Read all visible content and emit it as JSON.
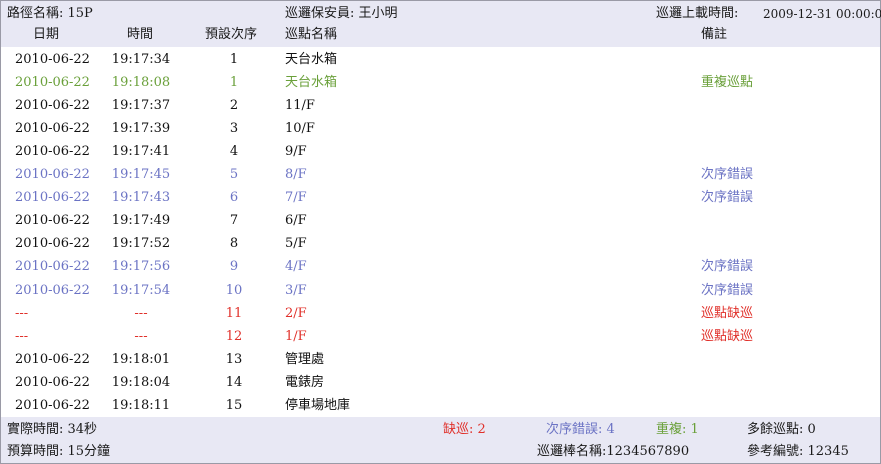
{
  "header": {
    "route_label": "路徑名稱: 15P",
    "guard_label": "巡邏保安員: 王小明",
    "upload_label": "巡邏上載時間:",
    "upload_time": "2009-12-31 00:00:01"
  },
  "columns": {
    "date": "日期",
    "time": "時間",
    "seq": "預設次序",
    "name": "巡點名稱",
    "note": "備註"
  },
  "rows": [
    {
      "date": "2010-06-22",
      "time": "19:17:34",
      "seq": "1",
      "name": "天台水箱",
      "note": "",
      "status": "normal"
    },
    {
      "date": "2010-06-22",
      "time": "19:18:08",
      "seq": "1",
      "name": "天台水箱",
      "note": "重複巡點",
      "status": "repeat"
    },
    {
      "date": "2010-06-22",
      "time": "19:17:37",
      "seq": "2",
      "name": "11/F",
      "note": "",
      "status": "normal"
    },
    {
      "date": "2010-06-22",
      "time": "19:17:39",
      "seq": "3",
      "name": "10/F",
      "note": "",
      "status": "normal"
    },
    {
      "date": "2010-06-22",
      "time": "19:17:41",
      "seq": "4",
      "name": "9/F",
      "note": "",
      "status": "normal"
    },
    {
      "date": "2010-06-22",
      "time": "19:17:45",
      "seq": "5",
      "name": "8/F",
      "note": "次序錯誤",
      "status": "order"
    },
    {
      "date": "2010-06-22",
      "time": "19:17:43",
      "seq": "6",
      "name": "7/F",
      "note": "次序錯誤",
      "status": "order"
    },
    {
      "date": "2010-06-22",
      "time": "19:17:49",
      "seq": "7",
      "name": "6/F",
      "note": "",
      "status": "normal"
    },
    {
      "date": "2010-06-22",
      "time": "19:17:52",
      "seq": "8",
      "name": "5/F",
      "note": "",
      "status": "normal"
    },
    {
      "date": "2010-06-22",
      "time": "19:17:56",
      "seq": "9",
      "name": "4/F",
      "note": "次序錯誤",
      "status": "order"
    },
    {
      "date": "2010-06-22",
      "time": "19:17:54",
      "seq": "10",
      "name": "3/F",
      "note": "次序錯誤",
      "status": "order"
    },
    {
      "date": "---",
      "time": "---",
      "seq": "11",
      "name": "2/F",
      "note": "巡點缺巡",
      "status": "missing"
    },
    {
      "date": "---",
      "time": "---",
      "seq": "12",
      "name": "1/F",
      "note": "巡點缺巡",
      "status": "missing"
    },
    {
      "date": "2010-06-22",
      "time": "19:18:01",
      "seq": "13",
      "name": "管理處",
      "note": "",
      "status": "normal"
    },
    {
      "date": "2010-06-22",
      "time": "19:18:04",
      "seq": "14",
      "name": "電錶房",
      "note": "",
      "status": "normal"
    },
    {
      "date": "2010-06-22",
      "time": "19:18:11",
      "seq": "15",
      "name": "停車場地庫",
      "note": "",
      "status": "normal"
    }
  ],
  "footer": {
    "actual_time": "實際時間: 34秒",
    "budget_time": "預算時間: 15分鐘",
    "missing": "缺巡: 2",
    "order_error": "次序錯誤: 4",
    "repeat": "重複: 1",
    "extra": "多餘巡點: 0",
    "stick_name": "巡邏棒名稱:1234567890",
    "ref_no": "參考編號: 12345"
  },
  "colors": {
    "normal": "#111111",
    "repeat": "#6aa03a",
    "order_error": "#6b73c4",
    "missing": "#e0302a",
    "bar_background": "#e8e8f4"
  }
}
